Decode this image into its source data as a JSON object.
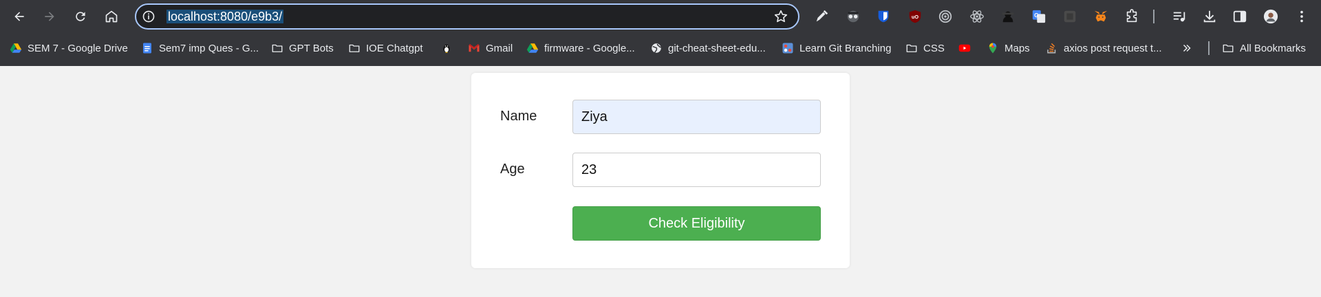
{
  "browser": {
    "url": "localhost:8080/e9b3/",
    "colors": {
      "chrome": "#35363a",
      "omnibox": "#202124",
      "focus_ring": "#a8c7fa"
    },
    "toolbar_icons": [
      "back-icon",
      "forward-icon",
      "reload-icon",
      "home-icon",
      "site-info-icon",
      "star-icon"
    ],
    "extensions": [
      "eyedropper-icon",
      "spy-icon",
      "bitwarden-icon",
      "ublock-icon",
      "target-icon",
      "react-icon",
      "hacker-icon",
      "translate-icon",
      "dark-extension-icon",
      "metamask-icon",
      "puzzle-icon",
      "media-icon",
      "download-icon",
      "sidepanel-icon",
      "profile-avatar-icon",
      "menu-dots-icon"
    ]
  },
  "bookmarks": [
    {
      "label": "SEM 7 - Google Drive",
      "icon": "drive-icon"
    },
    {
      "label": "Sem7 imp Ques - G...",
      "icon": "docs-icon"
    },
    {
      "label": "GPT Bots",
      "icon": "folder-icon"
    },
    {
      "label": "IOE Chatgpt",
      "icon": "folder-icon"
    },
    {
      "label": "",
      "icon": "linux-tux-icon"
    },
    {
      "label": "Gmail",
      "icon": "gmail-icon"
    },
    {
      "label": "firmware - Google...",
      "icon": "drive-icon"
    },
    {
      "label": "git-cheat-sheet-edu...",
      "icon": "globe-icon"
    },
    {
      "label": "Learn Git Branching",
      "icon": "git-branch-icon"
    },
    {
      "label": "CSS",
      "icon": "folder-icon"
    },
    {
      "label": "",
      "icon": "youtube-icon"
    },
    {
      "label": "Maps",
      "icon": "maps-icon"
    },
    {
      "label": "axios post request t...",
      "icon": "stackoverflow-icon"
    },
    {
      "label": "All Bookmarks",
      "icon": "folder-icon"
    }
  ],
  "form": {
    "name_label": "Name",
    "name_value": "Ziya",
    "age_label": "Age",
    "age_value": "23",
    "button_label": "Check Eligibility",
    "colors": {
      "button": "#4caf50",
      "autofill": "#e8f0fe",
      "card": "#ffffff",
      "page": "#f2f2f2"
    }
  }
}
